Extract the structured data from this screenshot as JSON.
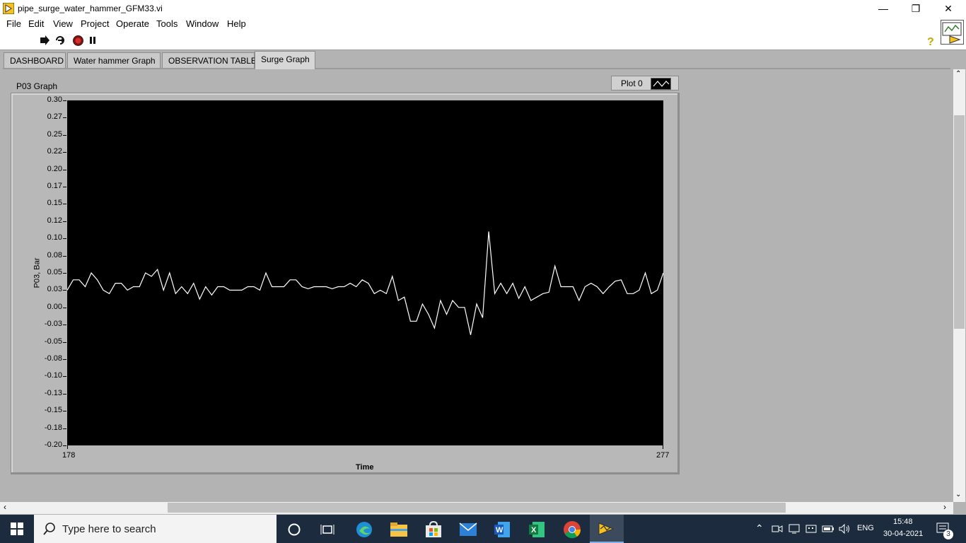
{
  "window": {
    "title": "pipe_surge_water_hammer_GFM33.vi"
  },
  "menu": [
    "File",
    "Edit",
    "View",
    "Project",
    "Operate",
    "Tools",
    "Window",
    "Help"
  ],
  "tabs": [
    {
      "label": "DASHBOARD",
      "active": false
    },
    {
      "label": "Water hammer Graph",
      "active": false
    },
    {
      "label": "OBSERVATION TABLE",
      "active": false
    },
    {
      "label": "Surge Graph",
      "active": true
    }
  ],
  "graph": {
    "label": "P03 Graph",
    "legend": "Plot 0",
    "y_ticks": [
      "0.30",
      "0.27",
      "0.25",
      "0.22",
      "0.20",
      "0.17",
      "0.15",
      "0.12",
      "0.10",
      "0.08",
      "0.05",
      "0.03",
      "0.00",
      "-0.03",
      "-0.05",
      "-0.08",
      "-0.10",
      "-0.13",
      "-0.15",
      "-0.18",
      "-0.20"
    ],
    "x_min": "178",
    "x_max": "277"
  },
  "chart_data": {
    "type": "line",
    "xlabel": "Time",
    "ylabel": "P03, Bar",
    "xlim": [
      178,
      277
    ],
    "ylim": [
      -0.2,
      0.3
    ],
    "grid": false,
    "line_color": "#ffffff",
    "x": [
      178,
      179,
      180,
      181,
      182,
      183,
      184,
      185,
      186,
      187,
      188,
      189,
      190,
      191,
      192,
      193,
      194,
      195,
      196,
      197,
      198,
      199,
      200,
      201,
      202,
      203,
      204,
      205,
      206,
      207,
      208,
      209,
      210,
      211,
      212,
      213,
      214,
      215,
      216,
      217,
      218,
      219,
      220,
      221,
      222,
      223,
      224,
      225,
      226,
      227,
      228,
      229,
      230,
      231,
      232,
      233,
      234,
      235,
      236,
      237,
      238,
      239,
      240,
      241,
      242,
      243,
      244,
      245,
      246,
      247,
      248,
      249,
      250,
      251,
      252,
      253,
      254,
      255,
      256,
      257,
      258,
      259,
      260,
      261,
      262,
      263,
      264,
      265,
      266,
      267,
      268,
      269,
      270,
      271,
      272,
      273,
      274,
      275,
      276,
      277
    ],
    "series": [
      {
        "values": [
          0.025,
          0.04,
          0.04,
          0.03,
          0.05,
          0.04,
          0.025,
          0.02,
          0.035,
          0.035,
          0.025,
          0.03,
          0.03,
          0.05,
          0.045,
          0.055,
          0.025,
          0.05,
          0.02,
          0.03,
          0.02,
          0.035,
          0.012,
          0.03,
          0.018,
          0.03,
          0.03,
          0.025,
          0.025,
          0.025,
          0.03,
          0.03,
          0.025,
          0.05,
          0.03,
          0.03,
          0.03,
          0.04,
          0.04,
          0.03,
          0.027,
          0.03,
          0.03,
          0.03,
          0.027,
          0.03,
          0.03,
          0.035,
          0.03,
          0.04,
          0.035,
          0.02,
          0.025,
          0.02,
          0.045,
          0.01,
          0.015,
          -0.02,
          -0.02,
          0.005,
          -0.01,
          -0.03,
          0.01,
          -0.01,
          0.01,
          0.0,
          0.0,
          -0.04,
          0.005,
          -0.015,
          0.11,
          0.02,
          0.035,
          0.02,
          0.035,
          0.013,
          0.03,
          0.01,
          0.015,
          0.02,
          0.022,
          0.06,
          0.03,
          0.03,
          0.03,
          0.01,
          0.03,
          0.035,
          0.03,
          0.02,
          0.03,
          0.038,
          0.04,
          0.02,
          0.02,
          0.025,
          0.05,
          0.02,
          0.025,
          0.05
        ]
      }
    ]
  },
  "taskbar": {
    "search_placeholder": "Type here to search",
    "language": "ENG",
    "time": "15:48",
    "date": "30-04-2021",
    "notifications": "3"
  }
}
